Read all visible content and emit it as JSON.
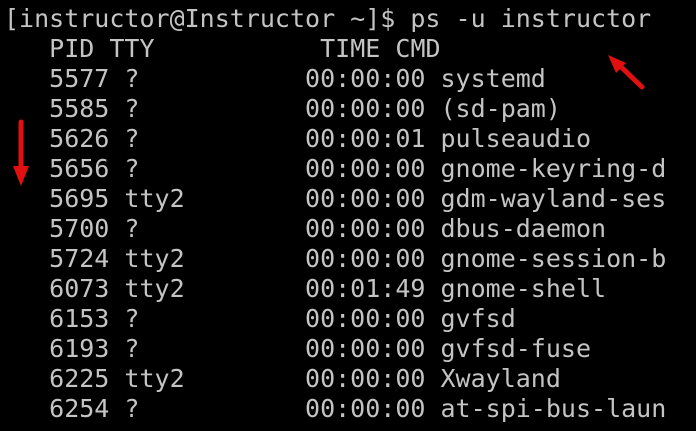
{
  "terminal": {
    "prompt": "[instructor@Instructor ~]$ ps -u instructor",
    "header": {
      "pid": "PID",
      "tty": "TTY",
      "time": "TIME",
      "cmd": "CMD"
    },
    "processes": [
      {
        "pid": "5577",
        "tty": "?",
        "time": "00:00:00",
        "cmd": "systemd"
      },
      {
        "pid": "5585",
        "tty": "?",
        "time": "00:00:00",
        "cmd": "(sd-pam)"
      },
      {
        "pid": "5626",
        "tty": "?",
        "time": "00:00:01",
        "cmd": "pulseaudio"
      },
      {
        "pid": "5656",
        "tty": "?",
        "time": "00:00:00",
        "cmd": "gnome-keyring-d"
      },
      {
        "pid": "5695",
        "tty": "tty2",
        "time": "00:00:00",
        "cmd": "gdm-wayland-ses"
      },
      {
        "pid": "5700",
        "tty": "?",
        "time": "00:00:00",
        "cmd": "dbus-daemon"
      },
      {
        "pid": "5724",
        "tty": "tty2",
        "time": "00:00:00",
        "cmd": "gnome-session-b"
      },
      {
        "pid": "6073",
        "tty": "tty2",
        "time": "00:01:49",
        "cmd": "gnome-shell"
      },
      {
        "pid": "6153",
        "tty": "?",
        "time": "00:00:00",
        "cmd": "gvfsd"
      },
      {
        "pid": "6193",
        "tty": "?",
        "time": "00:00:00",
        "cmd": "gvfsd-fuse"
      },
      {
        "pid": "6225",
        "tty": "tty2",
        "time": "00:00:00",
        "cmd": "Xwayland"
      },
      {
        "pid": "6254",
        "tty": "?",
        "time": "00:00:00",
        "cmd": "at-spi-bus-laun"
      }
    ],
    "colors": {
      "background": "#000000",
      "text": "#c4c4c4",
      "annotation": "#e01010"
    }
  },
  "annotations": {
    "arrows": [
      "red-arrow-pointing-to-command",
      "red-arrow-pointing-down-rows"
    ]
  }
}
